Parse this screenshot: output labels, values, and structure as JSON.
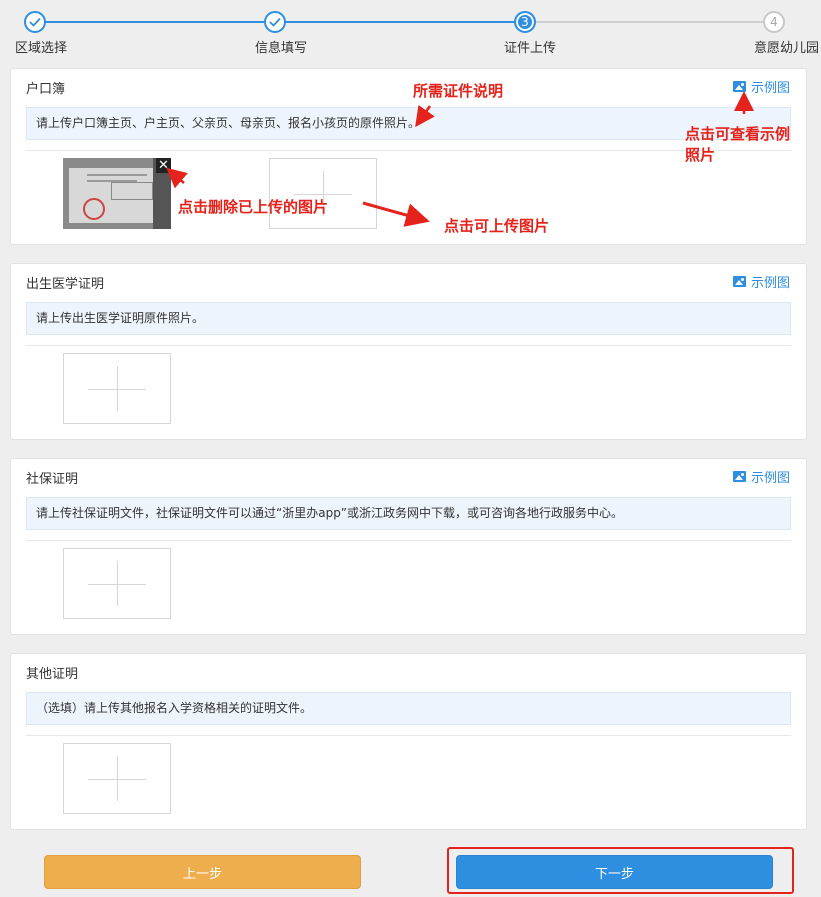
{
  "stepper": {
    "steps": [
      {
        "label": "区域选择",
        "state": "done"
      },
      {
        "label": "信息填写",
        "state": "done"
      },
      {
        "label": "证件上传",
        "state": "current",
        "number": "3"
      },
      {
        "label": "意愿幼儿园",
        "state": "todo",
        "number": "4"
      }
    ]
  },
  "sections": [
    {
      "title": "户口簿",
      "example_label": "示例图",
      "description": "请上传户口簿主页、户主页、父亲页、母亲页、报名小孩页的原件照片。",
      "close_glyph": "✕"
    },
    {
      "title": "出生医学证明",
      "example_label": "示例图",
      "description": "请上传出生医学证明原件照片。"
    },
    {
      "title": "社保证明",
      "example_label": "示例图",
      "description": "请上传社保证明文件，社保证明文件可以通过“浙里办app”或浙江政务网中下载，或可咨询各地行政服务中心。"
    },
    {
      "title": "其他证明",
      "description": "（选填）请上传其他报名入学资格相关的证明文件。"
    }
  ],
  "annotations": {
    "required_desc": "所需证件说明",
    "view_example_line1": "点击可查看示例",
    "view_example_line2": "照片",
    "delete_uploaded": "点击删除已上传的图片",
    "click_upload": "点击可上传图片"
  },
  "buttons": {
    "prev": "上一步",
    "next": "下一步"
  },
  "colors": {
    "accent": "#2e8ee0",
    "prev_button": "#eeae4e",
    "annotation": "#e3231c"
  }
}
